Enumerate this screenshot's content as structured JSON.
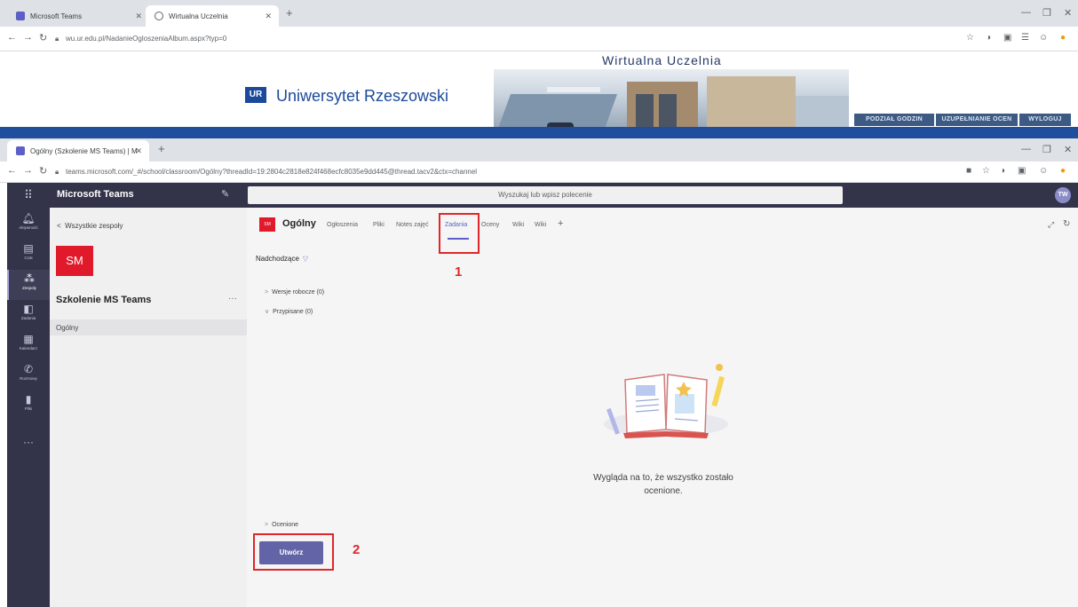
{
  "browser1": {
    "tabs": [
      {
        "label": "Microsoft Teams",
        "active": false
      },
      {
        "label": "Wirtualna Uczelnia",
        "active": true
      }
    ],
    "url": "wu.ur.edu.pl/NadanieOgloszeniaAlbum.aspx?typ=0"
  },
  "university": {
    "logo": "UR",
    "name": "Uniwersytet Rzeszowski",
    "portal_title": "Wirtualna Uczelnia",
    "buttons": [
      "PODZIAŁ GODZIN",
      "UZUPEŁNIANIE OCEN",
      "WYLOGUJ"
    ]
  },
  "browser2": {
    "tab": "Ogólny (Szkolenie MS Teams) | M",
    "url": "teams.microsoft.com/_#/school/classroom/Ogólny?threadId=19:2804c2818e824f468ecfc8035e9dd445@thread.tacv2&ctx=channel"
  },
  "teams": {
    "app_name": "Microsoft Teams",
    "search_placeholder": "Wyszukaj lub wpisz polecenie",
    "avatar": "TW",
    "rail": [
      {
        "label": "Aktywność",
        "icon": "bell-icon"
      },
      {
        "label": "Czat",
        "icon": "chat-icon"
      },
      {
        "label": "Zespoły",
        "icon": "teams-icon"
      },
      {
        "label": "Zadania",
        "icon": "assignments-icon"
      },
      {
        "label": "Kalendarz",
        "icon": "calendar-icon"
      },
      {
        "label": "Rozmowy",
        "icon": "phone-icon"
      },
      {
        "label": "Pliki",
        "icon": "files-icon"
      }
    ],
    "sidebar": {
      "back": "Wszystkie zespoły",
      "team_initials": "SM",
      "team_name": "Szkolenie MS Teams",
      "more": "···",
      "channel": "Ogólny"
    },
    "channel": {
      "chip": "SM",
      "name": "Ogólny",
      "tabs": [
        "Ogłoszenia",
        "Pliki",
        "Notes zajęć",
        "Zadania",
        "Oceny",
        "Wiki",
        "Wiki"
      ],
      "active_tab": "Zadania"
    },
    "assignments": {
      "filter": "Nadchodzące",
      "groups": [
        "Wersje robocze (0)",
        "Przypisane (0)",
        "Ocenione"
      ],
      "empty_line1": "Wygląda na to, że wszystko zostało",
      "empty_line2": "ocenione.",
      "create_button": "Utwórz"
    },
    "annotations": [
      "1",
      "2"
    ],
    "colors": {
      "header": "#33344a",
      "accent": "#6264a7",
      "team_tile": "#e0192b",
      "annotation": "#e0262b"
    }
  }
}
